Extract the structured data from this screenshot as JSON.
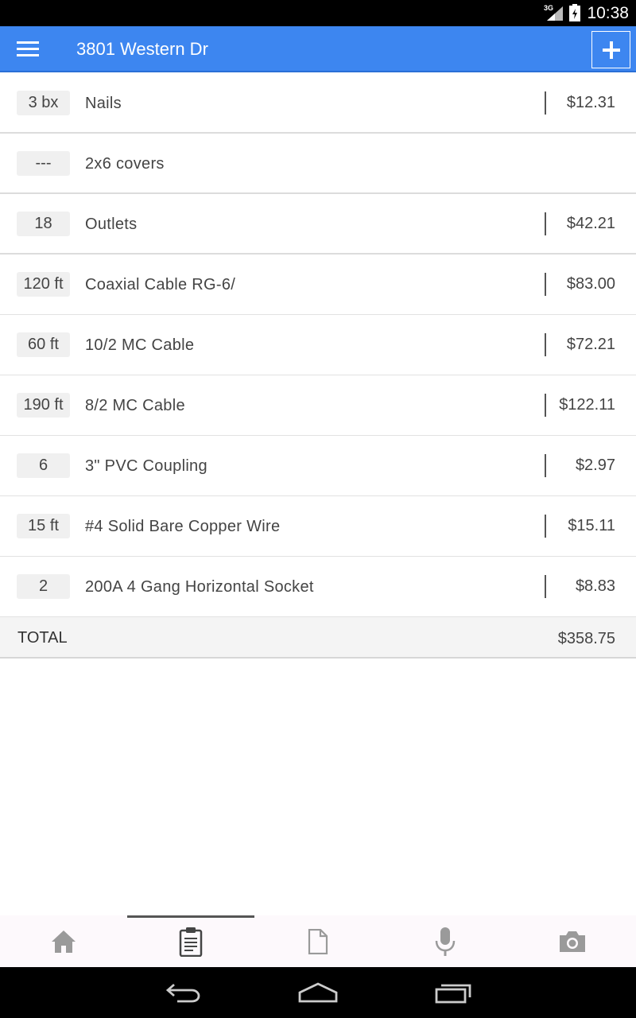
{
  "status_bar": {
    "network_label": "3G",
    "time": "10:38"
  },
  "app_bar": {
    "title": "3801 Western Dr",
    "menu_icon": "hamburger-menu-icon",
    "add_icon": "plus-icon"
  },
  "items": [
    {
      "qty": "3 bx",
      "name": "Nails",
      "price": "$12.31"
    },
    {
      "qty": "---",
      "name": "2x6 covers",
      "price": ""
    },
    {
      "qty": "18",
      "name": "Outlets",
      "price": "$42.21"
    },
    {
      "qty": "120 ft",
      "name": "Coaxial Cable RG-6/",
      "price": "$83.00"
    },
    {
      "qty": "60 ft",
      "name": "10/2 MC Cable",
      "price": "$72.21"
    },
    {
      "qty": "190 ft",
      "name": "8/2 MC Cable",
      "price": "$122.11"
    },
    {
      "qty": "6",
      "name": "3\" PVC Coupling",
      "price": "$2.97"
    },
    {
      "qty": "15 ft",
      "name": "#4 Solid Bare Copper Wire",
      "price": "$15.11"
    },
    {
      "qty": "2",
      "name": "200A 4 Gang Horizontal Socket",
      "price": "$8.83"
    }
  ],
  "total": {
    "label": "TOTAL",
    "value": "$358.75"
  },
  "tabs": [
    {
      "icon": "home-icon",
      "active": false
    },
    {
      "icon": "clipboard-icon",
      "active": true
    },
    {
      "icon": "document-icon",
      "active": false
    },
    {
      "icon": "microphone-icon",
      "active": false
    },
    {
      "icon": "camera-icon",
      "active": false
    }
  ],
  "nav": {
    "back_icon": "back-icon",
    "home_icon": "home-nav-icon",
    "recents_icon": "recent-apps-icon"
  },
  "colors": {
    "app_bar": "#3d86f0",
    "icon_gray": "#9a9a9a",
    "text": "#444444"
  }
}
